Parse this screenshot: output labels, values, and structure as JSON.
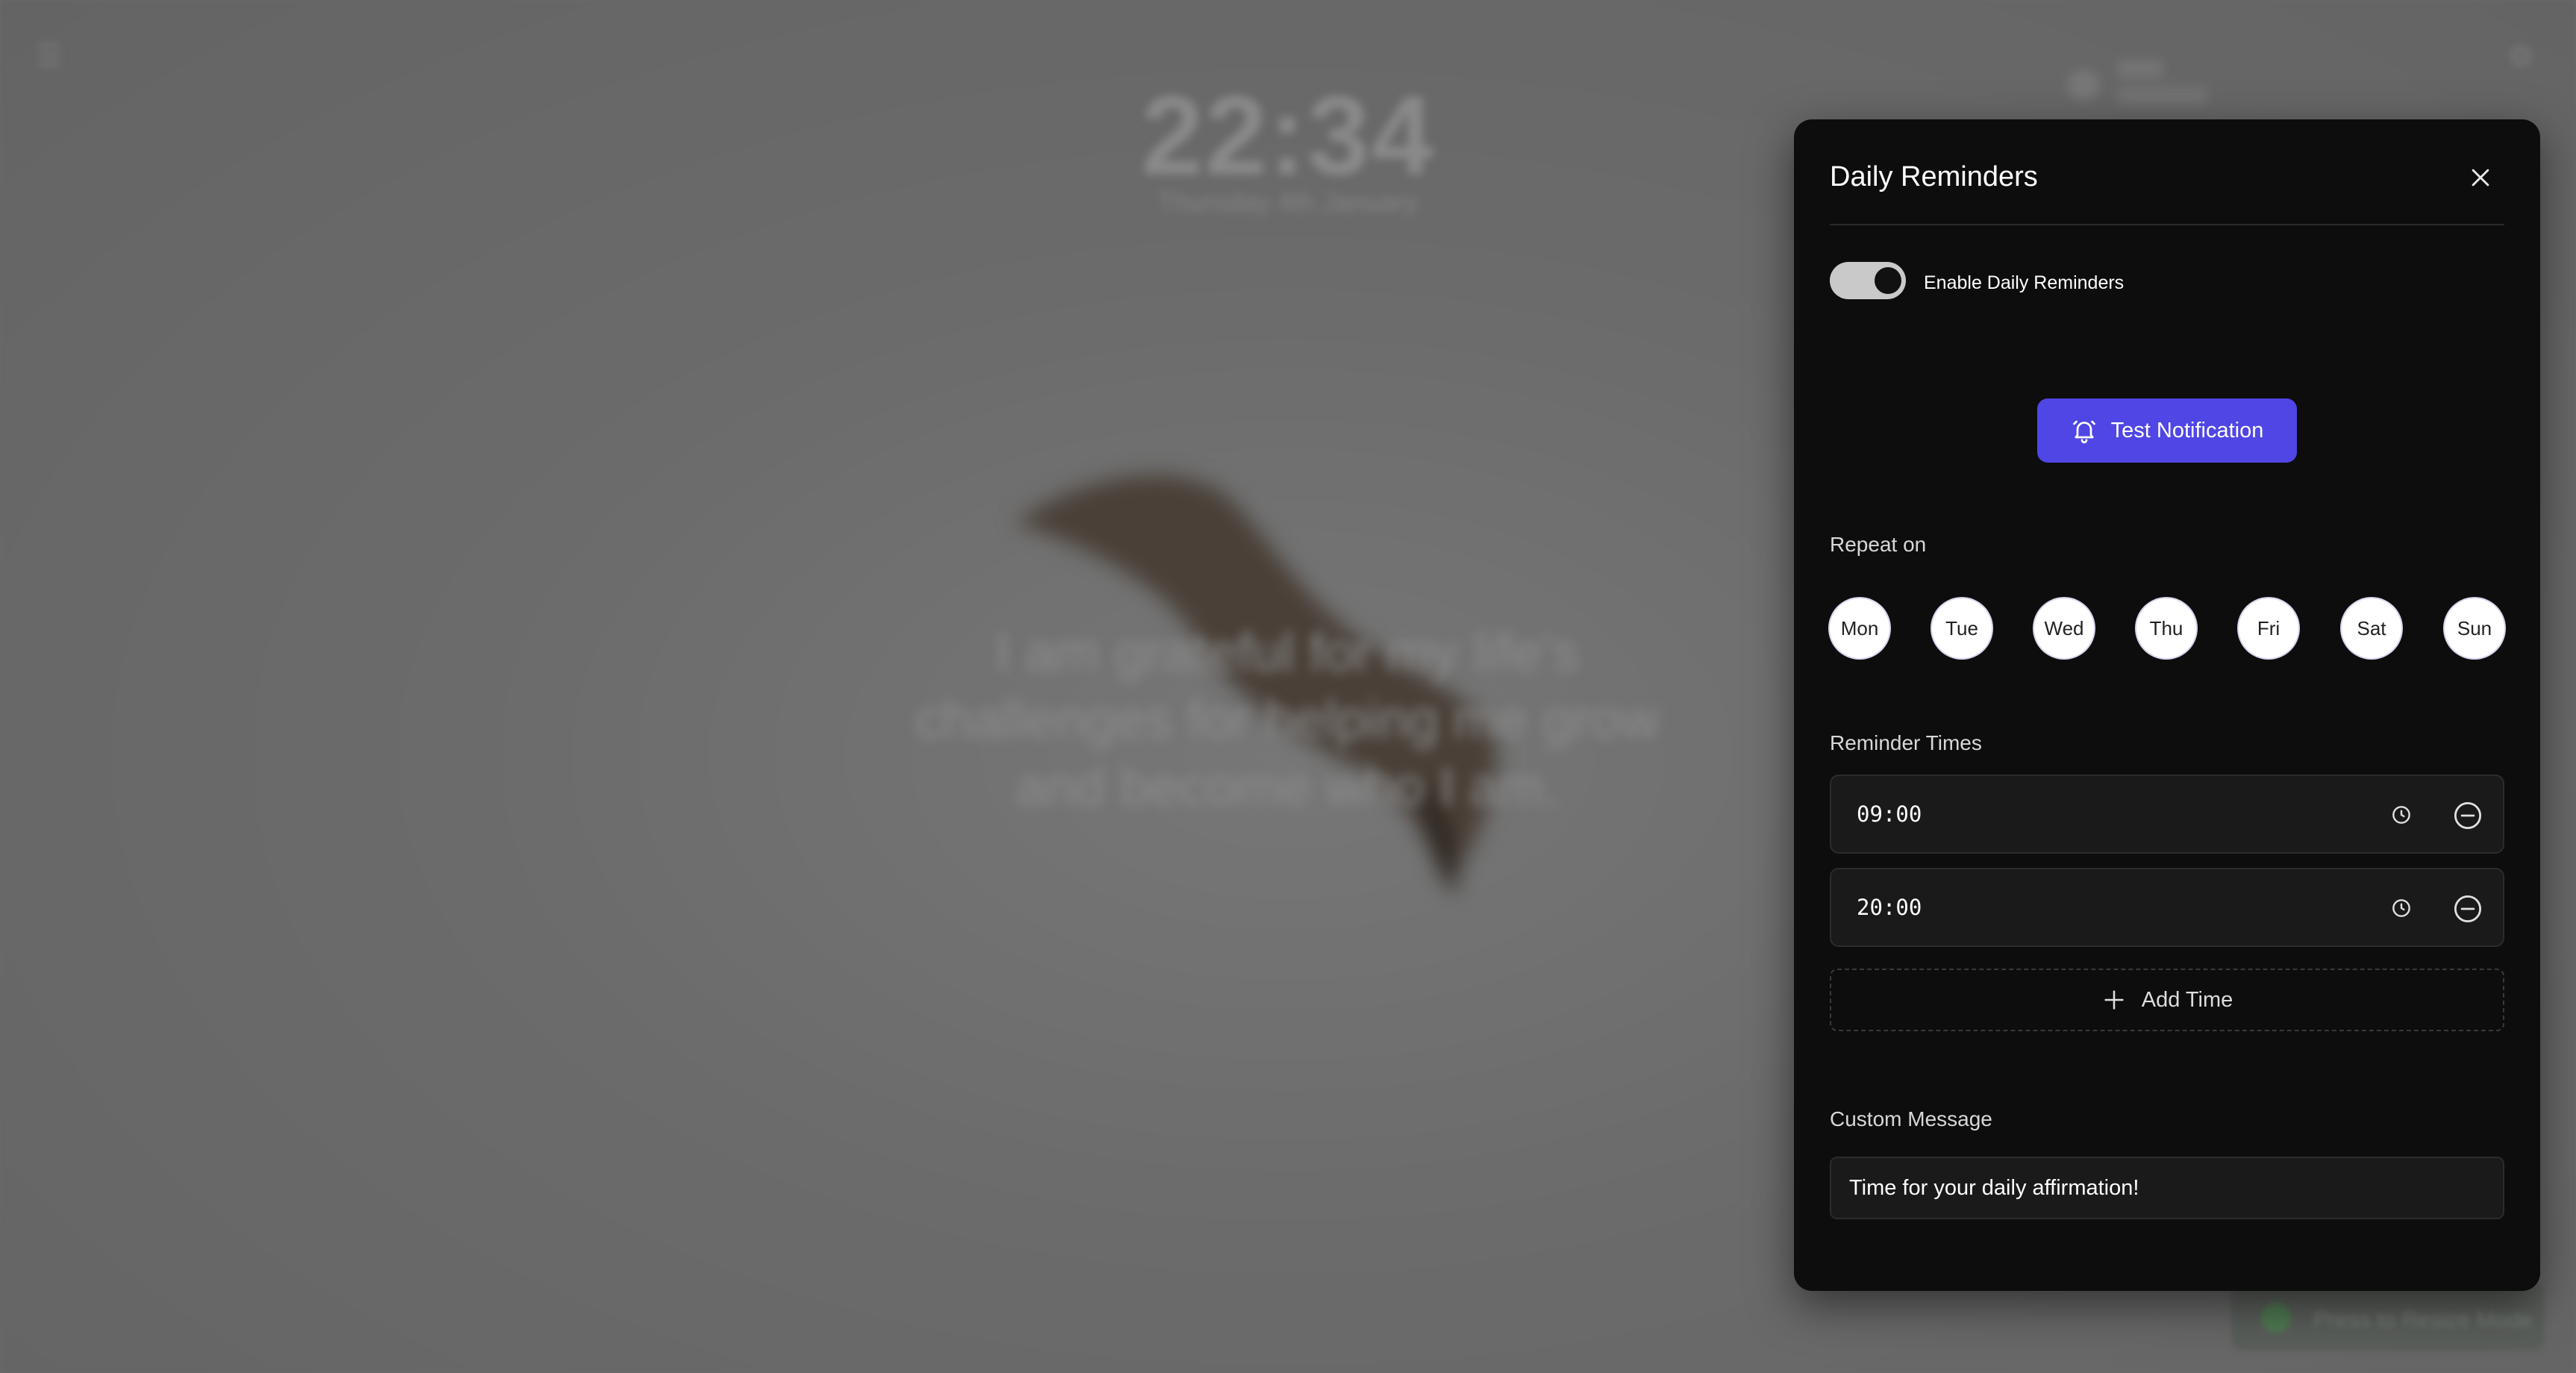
{
  "background": {
    "clock": "22:34",
    "date": "Thursday 4th January",
    "affirmation": "I am grateful for my life's challenges for helping me grow and become who I am.",
    "toast_text": "Press to Resize Mode"
  },
  "modal": {
    "title": "Daily Reminders",
    "close_icon": "close-icon",
    "toggle": {
      "label": "Enable Daily Reminders",
      "enabled": true
    },
    "test_button": {
      "label": "Test Notification",
      "icon": "bell-icon"
    },
    "repeat": {
      "label": "Repeat on",
      "days": [
        "Mon",
        "Tue",
        "Wed",
        "Thu",
        "Fri",
        "Sat",
        "Sun"
      ]
    },
    "reminder_times": {
      "label": "Reminder Times",
      "times": [
        "09:00",
        "20:00"
      ],
      "add_label": "Add Time"
    },
    "custom_message": {
      "label": "Custom Message",
      "value": "Time for your daily affirmation!"
    }
  },
  "colors": {
    "accent": "#4f46e5",
    "panel_bg": "#0d0d0d",
    "field_bg": "#1a1a1a"
  }
}
